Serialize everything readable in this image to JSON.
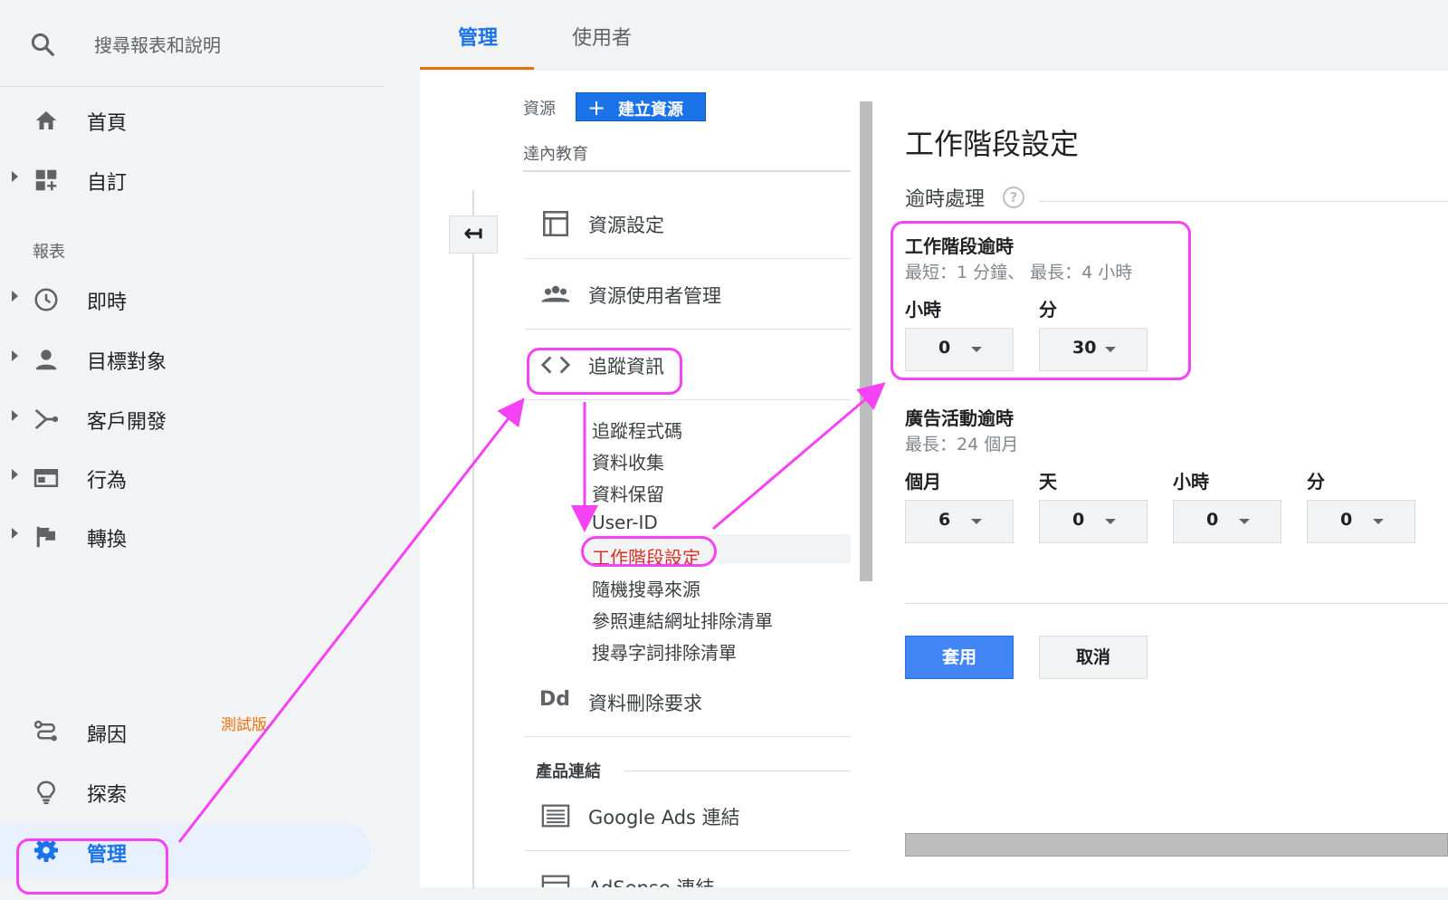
{
  "search": {
    "placeholder_text": "搜尋報表和說明"
  },
  "nav": {
    "home": "首頁",
    "customization": "自訂",
    "reports_section": "報表",
    "realtime": "即時",
    "audience": "目標對象",
    "acquisition": "客戶開發",
    "behavior": "行為",
    "conversions": "轉換",
    "attribution": "歸因",
    "attribution_badge": "測試版",
    "discover": "探索",
    "admin": "管理"
  },
  "tabs": [
    {
      "label": "管理",
      "active": true
    },
    {
      "label": "使用者",
      "active": false
    }
  ],
  "property": {
    "label": "資源",
    "create_button": "建立資源",
    "name": "達內教育",
    "menu": [
      {
        "label": "資源設定",
        "icon": "property-settings-icon"
      },
      {
        "label": "資源使用者管理",
        "icon": "users-icon"
      },
      {
        "label": "追蹤資訊",
        "icon": "code-icon"
      }
    ],
    "tracking_sub_items": [
      "追蹤程式碼",
      "資料收集",
      "資料保留",
      "User-ID",
      "工作階段設定",
      "隨機搜尋來源",
      "參照連結網址排除清單",
      "搜尋字詞排除清單"
    ],
    "selected_sub_item": "工作階段設定",
    "data_deletion": {
      "label": "資料刪除要求",
      "icon_text": "Dd"
    },
    "product_linking_header": "產品連結",
    "product_links": [
      "Google Ads 連結",
      "AdSense 連結"
    ]
  },
  "settings": {
    "title": "工作階段設定",
    "timeout_section": "逾時處理",
    "help_glyph": "?",
    "session_timeout": {
      "title": "工作階段逾時",
      "hint": "最短：1 分鐘、 最長：4 小時",
      "hours_label": "小時",
      "hours_value": "0",
      "minutes_label": "分",
      "minutes_value": "30"
    },
    "campaign_timeout": {
      "title": "廣告活動逾時",
      "hint": "最長：24 個月",
      "months_label": "個月",
      "months_value": "6",
      "days_label": "天",
      "days_value": "0",
      "hours_label": "小時",
      "hours_value": "0",
      "minutes_label": "分",
      "minutes_value": "0"
    },
    "apply_button": "套用",
    "cancel_button": "取消"
  },
  "colors": {
    "accent": "#1a73e8",
    "tab_underline": "#e8710a",
    "annotation": "#f542f5",
    "selected_text": "#d93025"
  }
}
